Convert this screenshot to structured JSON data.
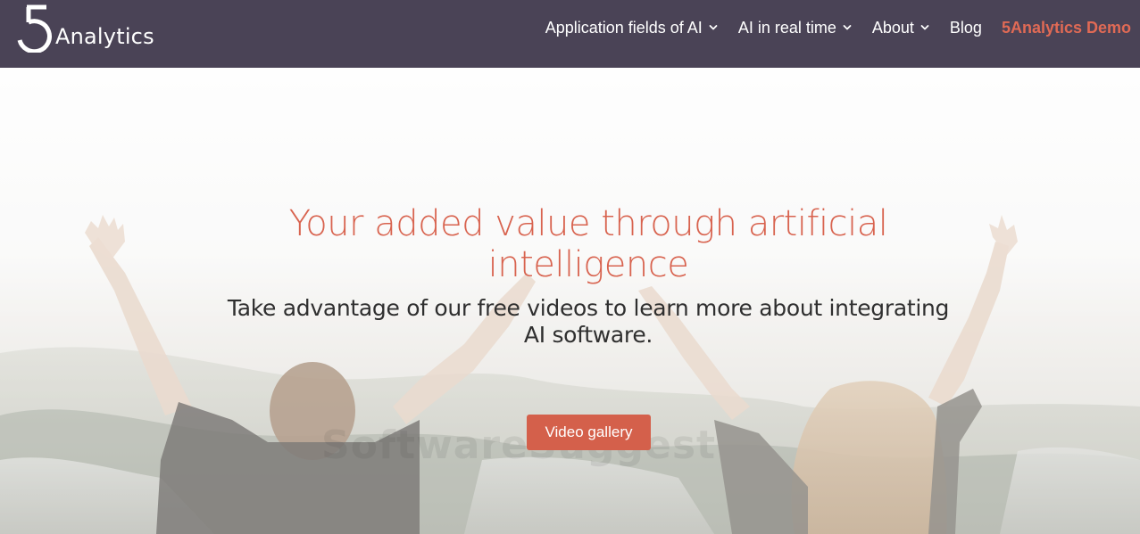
{
  "header": {
    "logo_text": "Analytics",
    "nav": [
      {
        "label": "Application fields of AI",
        "dropdown": true
      },
      {
        "label": "AI in real time",
        "dropdown": true
      },
      {
        "label": "About",
        "dropdown": true
      },
      {
        "label": "Blog",
        "dropdown": false
      },
      {
        "label": "5Analytics Demo",
        "dropdown": false
      }
    ]
  },
  "hero": {
    "title": "Your added value through artificial intelligence",
    "subtitle": "Take advantage of our free videos to learn more about integrating AI software.",
    "cta_label": "Video gallery",
    "watermark": "SoftwareSuggest"
  },
  "colors": {
    "header_bg": "#4a4356",
    "accent": "#d8634f",
    "demo_link": "#e06a55",
    "nav_text": "#ffffff",
    "subtitle_text": "#2f2f2f"
  },
  "icons": {
    "logo": "five-circle-logo-icon",
    "dropdown": "chevron-down-icon"
  }
}
